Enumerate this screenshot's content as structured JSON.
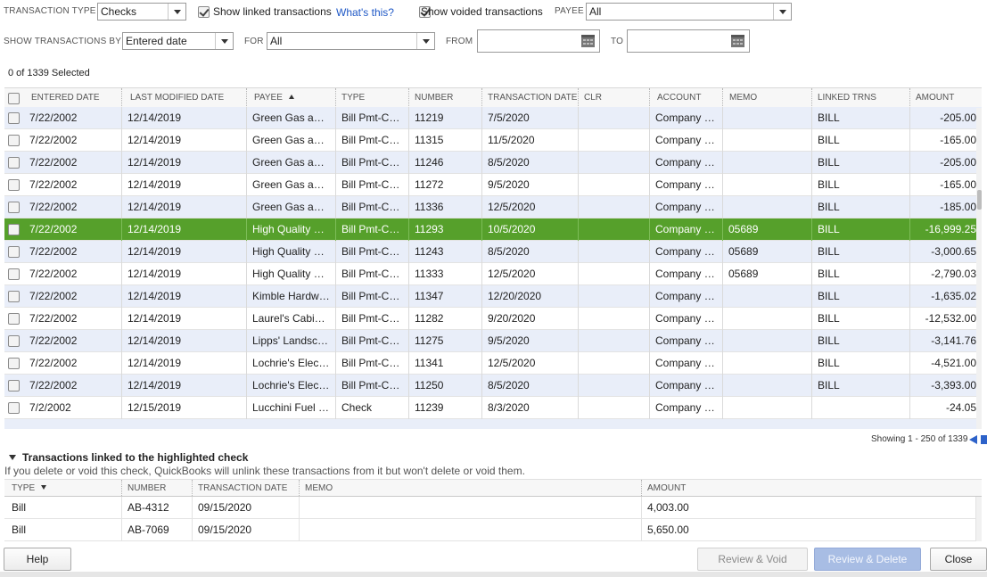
{
  "filters": {
    "transaction_type_label": "TRANSACTION TYPE",
    "transaction_type_value": "Checks",
    "show_linked_label": "Show linked transactions",
    "whats_this": "What's this?",
    "show_voided_label": "Show voided transactions",
    "payee_label": "PAYEE",
    "payee_value": "All",
    "show_by_label": "SHOW TRANSACTIONS BY",
    "show_by_value": "Entered date",
    "for_label": "FOR",
    "for_value": "All",
    "from_label": "FROM",
    "from_value": "",
    "to_label": "TO",
    "to_value": ""
  },
  "selection_count": "0 of 1339 Selected",
  "grid": {
    "columns": [
      "ENTERED DATE",
      "LAST MODIFIED DATE",
      "PAYEE",
      "TYPE",
      "NUMBER",
      "TRANSACTION DATE",
      "CLR",
      "ACCOUNT",
      "MEMO",
      "LINKED TRNS",
      "AMOUNT"
    ],
    "payee_sort_icon": "sort-ascending-icon",
    "rows": [
      {
        "entered": "7/22/2002",
        "modified": "12/14/2019",
        "payee": "Green Gas and Gas",
        "type": "Bill Pmt-Check",
        "number": "11219",
        "tdate": "7/5/2020",
        "clr": "",
        "account": "Company Checking",
        "memo": "",
        "linked": "BILL",
        "amount": "-205.00"
      },
      {
        "entered": "7/22/2002",
        "modified": "12/14/2019",
        "payee": "Green Gas and Gas",
        "type": "Bill Pmt-Check",
        "number": "11315",
        "tdate": "11/5/2020",
        "clr": "",
        "account": "Company Checking",
        "memo": "",
        "linked": "BILL",
        "amount": "-165.00"
      },
      {
        "entered": "7/22/2002",
        "modified": "12/14/2019",
        "payee": "Green Gas and Gas",
        "type": "Bill Pmt-Check",
        "number": "11246",
        "tdate": "8/5/2020",
        "clr": "",
        "account": "Company Checking",
        "memo": "",
        "linked": "BILL",
        "amount": "-205.00"
      },
      {
        "entered": "7/22/2002",
        "modified": "12/14/2019",
        "payee": "Green Gas and Gas",
        "type": "Bill Pmt-Check",
        "number": "11272",
        "tdate": "9/5/2020",
        "clr": "",
        "account": "Company Checking",
        "memo": "",
        "linked": "BILL",
        "amount": "-165.00"
      },
      {
        "entered": "7/22/2002",
        "modified": "12/14/2019",
        "payee": "Green Gas and Gas",
        "type": "Bill Pmt-Check",
        "number": "11336",
        "tdate": "12/5/2020",
        "clr": "",
        "account": "Company Checking",
        "memo": "",
        "linked": "BILL",
        "amount": "-185.00"
      },
      {
        "entered": "7/22/2002",
        "modified": "12/14/2019",
        "payee": "High Quality Lumber",
        "type": "Bill Pmt-Check",
        "number": "11293",
        "tdate": "10/5/2020",
        "clr": "",
        "account": "Company Checking",
        "memo": "05689",
        "linked": "BILL",
        "amount": "-16,999.25",
        "highlighted": true
      },
      {
        "entered": "7/22/2002",
        "modified": "12/14/2019",
        "payee": "High Quality Lumber",
        "type": "Bill Pmt-Check",
        "number": "11243",
        "tdate": "8/5/2020",
        "clr": "",
        "account": "Company Checking",
        "memo": "05689",
        "linked": "BILL",
        "amount": "-3,000.65"
      },
      {
        "entered": "7/22/2002",
        "modified": "12/14/2019",
        "payee": "High Quality Lumber",
        "type": "Bill Pmt-Check",
        "number": "11333",
        "tdate": "12/5/2020",
        "clr": "",
        "account": "Company Checking",
        "memo": "05689",
        "linked": "BILL",
        "amount": "-2,790.03"
      },
      {
        "entered": "7/22/2002",
        "modified": "12/14/2019",
        "payee": "Kimble Hardware",
        "type": "Bill Pmt-Check",
        "number": "11347",
        "tdate": "12/20/2020",
        "clr": "",
        "account": "Company Checking",
        "memo": "",
        "linked": "BILL",
        "amount": "-1,635.02"
      },
      {
        "entered": "7/22/2002",
        "modified": "12/14/2019",
        "payee": "Laurel's Cabinets",
        "type": "Bill Pmt-Check",
        "number": "11282",
        "tdate": "9/20/2020",
        "clr": "",
        "account": "Company Checking",
        "memo": "",
        "linked": "BILL",
        "amount": "-12,532.00"
      },
      {
        "entered": "7/22/2002",
        "modified": "12/14/2019",
        "payee": "Lipps' Landscaping",
        "type": "Bill Pmt-Check",
        "number": "11275",
        "tdate": "9/5/2020",
        "clr": "",
        "account": "Company Checking",
        "memo": "",
        "linked": "BILL",
        "amount": "-3,141.76"
      },
      {
        "entered": "7/22/2002",
        "modified": "12/14/2019",
        "payee": "Lochrie's Electric",
        "type": "Bill Pmt-Check",
        "number": "11341",
        "tdate": "12/5/2020",
        "clr": "",
        "account": "Company Checking",
        "memo": "",
        "linked": "BILL",
        "amount": "-4,521.00"
      },
      {
        "entered": "7/22/2002",
        "modified": "12/14/2019",
        "payee": "Lochrie's Electric",
        "type": "Bill Pmt-Check",
        "number": "11250",
        "tdate": "8/5/2020",
        "clr": "",
        "account": "Company Checking",
        "memo": "",
        "linked": "BILL",
        "amount": "-3,393.00"
      },
      {
        "entered": "7/2/2002",
        "modified": "12/15/2019",
        "payee": "Lucchini Fuel Supply",
        "type": "Check",
        "number": "11239",
        "tdate": "8/3/2020",
        "clr": "",
        "account": "Company Checking",
        "memo": "",
        "linked": "",
        "amount": "-24.05"
      }
    ]
  },
  "pager": {
    "showing": "Showing 1 - 250 of 1339",
    "prev_icon": "previous-page-icon"
  },
  "linked_section": {
    "title": "Transactions linked to the highlighted check",
    "toggle_icon": "collapse-triangle-icon",
    "note": "If you delete or void this check, QuickBooks will unlink these transactions from it but won't delete or void them.",
    "columns": [
      "TYPE",
      "NUMBER",
      "TRANSACTION DATE",
      "MEMO",
      "AMOUNT"
    ],
    "rows": [
      {
        "type": "Bill",
        "number": "AB-4312",
        "tdate": "09/15/2020",
        "memo": "",
        "amount": "4,003.00"
      },
      {
        "type": "Bill",
        "number": "AB-7069",
        "tdate": "09/15/2020",
        "memo": "",
        "amount": "5,650.00"
      }
    ]
  },
  "buttons": {
    "help": "Help",
    "review_void": "Review & Void",
    "review_delete": "Review & Delete",
    "close": "Close"
  },
  "colors": {
    "highlight_row": "#56a02b",
    "alt_row": "#e9eef9",
    "link": "#1f58c6"
  }
}
